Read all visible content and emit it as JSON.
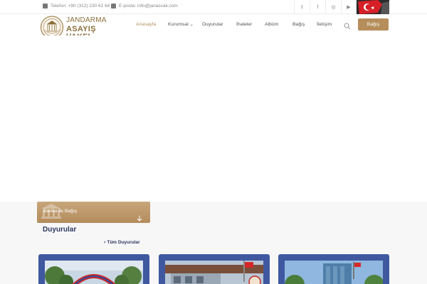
{
  "topbar": {
    "phone": "Telefon: +90 (312) 230 62 64",
    "email": "E-posta: info@janasvak.com",
    "social": [
      {
        "icon": "twitter-icon",
        "glyph": "𝕥"
      },
      {
        "icon": "facebook-icon",
        "glyph": "f"
      },
      {
        "icon": "instagram-icon",
        "glyph": "◎"
      },
      {
        "icon": "youtube-icon",
        "glyph": "▶"
      }
    ]
  },
  "brand": {
    "line1": "JANDARMA",
    "line2": "ASAYIŞ VAKFI"
  },
  "nav": {
    "items": [
      "Anasayfa",
      "Kurumsal",
      "Duyurular",
      "İhaleler",
      "Albüm",
      "Bağış",
      "İletişim"
    ],
    "active_index": 0,
    "dropdown_index": 1,
    "donate_label": "Bağış"
  },
  "bank_card": {
    "label": "Banka ile Bağış"
  },
  "announcements": {
    "title": "Duyurular",
    "all_link": "Tüm Duyurular"
  },
  "colors": {
    "accent": "#b58e5c",
    "navy": "#2c3760",
    "card_blue": "#3f58a0"
  }
}
